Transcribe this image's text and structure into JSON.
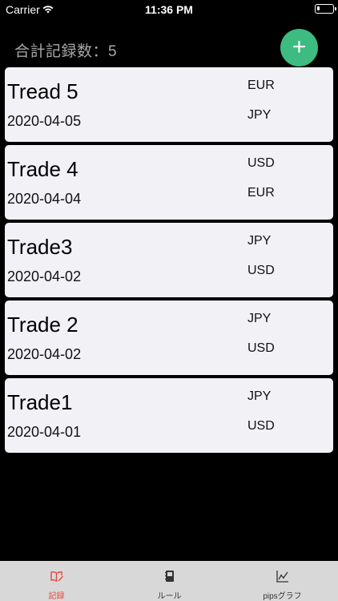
{
  "status_bar": {
    "carrier": "Carrier",
    "time": "11:36 PM"
  },
  "header": {
    "record_count": "合計記録数：5",
    "add_button_label": "+"
  },
  "trades": [
    {
      "name": "Tread 5",
      "date": "2020-04-05",
      "currency_1": "EUR",
      "currency_2": "JPY"
    },
    {
      "name": "Trade 4",
      "date": "2020-04-04",
      "currency_1": "USD",
      "currency_2": "EUR"
    },
    {
      "name": "Trade3",
      "date": "2020-04-02",
      "currency_1": "JPY",
      "currency_2": "USD"
    },
    {
      "name": "Trade 2",
      "date": "2020-04-02",
      "currency_1": "JPY",
      "currency_2": "USD"
    },
    {
      "name": "Trade1",
      "date": "2020-04-01",
      "currency_1": "JPY",
      "currency_2": "USD"
    }
  ],
  "tab_bar": {
    "tabs": [
      {
        "label": "記録",
        "icon": "record-book-icon",
        "active": true
      },
      {
        "label": "ルール",
        "icon": "rule-notebook-icon",
        "active": false
      },
      {
        "label": "pipsグラフ",
        "icon": "line-graph-icon",
        "active": false
      }
    ]
  },
  "colors": {
    "background": "#000000",
    "card": "#f2f1f6",
    "accent_green": "#3dbb80",
    "active_tab": "#e8453c",
    "tab_bar": "#d8d8d8"
  }
}
